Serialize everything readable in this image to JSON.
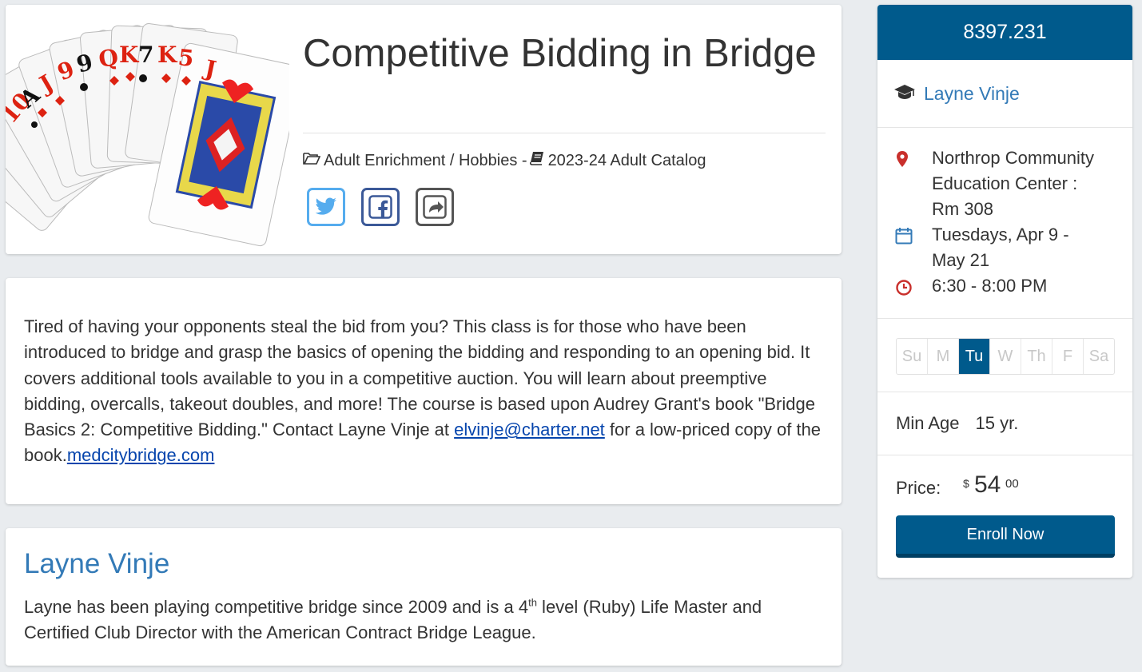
{
  "course": {
    "title": "Competitive Bidding in Bridge",
    "category": "Adult Enrichment / Hobbies -",
    "catalog": "2023-24 Adult Catalog",
    "image_icon": "playing-cards-image"
  },
  "share": {
    "buttons": [
      "twitter-icon",
      "facebook-icon",
      "share-icon"
    ]
  },
  "description": {
    "text_before": "Tired of having your opponents steal the bid from you? This class is for those who have been introduced to bridge and grasp the basics of opening the bidding and responding to an opening bid. It covers additional tools available to you in a competitive auction. You will learn about preemptive bidding, overcalls, takeout doubles, and more! The course is based upon Audrey Grant's book \"Bridge Basics 2: Competitive Bidding.\" Contact Layne Vinje at ",
    "email_link": "elvinje@charter.net",
    "text_middle": " for a low-priced copy of the book.",
    "site_link": "medcitybridge.com"
  },
  "instructor_bio": {
    "name": "Layne Vinje",
    "text_a": "Layne has been playing competitive bridge since 2009 and is a 4",
    "superscript": "th",
    "text_b": " level (Ruby) Life Master and Certified Club Director with the American Contract Bridge League."
  },
  "sidebar": {
    "course_number": "8397.231",
    "instructor": "Layne Vinje",
    "location_1": "Northrop Community",
    "location_2": "Education Center :",
    "location_3": "Rm 308",
    "dates_1": "Tuesdays, Apr 9 -",
    "dates_2": "May 21",
    "time": "6:30 - 8:00 PM",
    "days": [
      {
        "label": "Su",
        "active": false
      },
      {
        "label": "M",
        "active": false
      },
      {
        "label": "Tu",
        "active": true
      },
      {
        "label": "W",
        "active": false
      },
      {
        "label": "Th",
        "active": false
      },
      {
        "label": "F",
        "active": false
      },
      {
        "label": "Sa",
        "active": false
      }
    ],
    "min_age_label": "Min Age",
    "min_age_value": "15 yr.",
    "price_label": "Price:",
    "price_currency": "$",
    "price_dollars": "54",
    "price_cents": "00",
    "enroll_label": "Enroll Now"
  },
  "colors": {
    "brand": "#005a8c",
    "link": "#337ab7",
    "twitter": "#55acee",
    "facebook": "#3b5998"
  }
}
